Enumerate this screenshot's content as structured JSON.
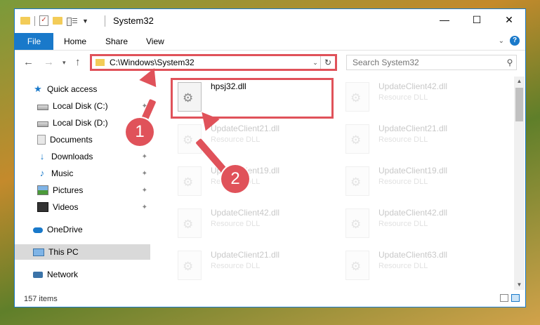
{
  "window": {
    "title": "System32",
    "controls": {
      "minimize": "—",
      "maximize": "☐",
      "close": "✕"
    }
  },
  "ribbon": {
    "tabs": [
      "File",
      "Home",
      "Share",
      "View"
    ],
    "expand_icon": "chevron-down-icon",
    "help_label": "?"
  },
  "address": {
    "path": "C:\\Windows\\System32",
    "search_placeholder": "Search System32"
  },
  "nav_pane": {
    "items": [
      {
        "label": "Quick access",
        "icon": "star-icon",
        "pinned": false
      },
      {
        "label": "Local Disk (C:)",
        "icon": "drive-icon",
        "pinned": true
      },
      {
        "label": "Local Disk (D:)",
        "icon": "drive-icon",
        "pinned": false
      },
      {
        "label": "Documents",
        "icon": "documents-icon",
        "pinned": true
      },
      {
        "label": "Downloads",
        "icon": "downloads-icon",
        "pinned": true
      },
      {
        "label": "Music",
        "icon": "music-icon",
        "pinned": true
      },
      {
        "label": "Pictures",
        "icon": "pictures-icon",
        "pinned": true
      },
      {
        "label": "Videos",
        "icon": "videos-icon",
        "pinned": true
      },
      {
        "label": "OneDrive",
        "icon": "cloud-icon",
        "pinned": false
      },
      {
        "label": "This PC",
        "icon": "computer-icon",
        "pinned": false,
        "selected": true
      },
      {
        "label": "Network",
        "icon": "network-icon",
        "pinned": false
      }
    ]
  },
  "files": [
    {
      "name": "hpsj32.dll",
      "type": "",
      "highlighted": true
    },
    {
      "name": "UpdateClient42.dll",
      "type": "Resource DLL"
    },
    {
      "name": "UpdateClient21.dll",
      "type": "Resource DLL"
    },
    {
      "name": "UpdateClient21.dll",
      "type": "Resource DLL"
    },
    {
      "name": "UpdateClient19.dll",
      "type": "Resource DLL"
    },
    {
      "name": "UpdateClient19.dll",
      "type": "Resource DLL"
    },
    {
      "name": "UpdateClient42.dll",
      "type": "Resource DLL"
    },
    {
      "name": "UpdateClient42.dll",
      "type": "Resource DLL"
    },
    {
      "name": "UpdateClient21.dll",
      "type": "Resource DLL"
    },
    {
      "name": "UpdateClient63.dll",
      "type": "Resource DLL"
    }
  ],
  "status": {
    "item_count": "157 items"
  },
  "annotations": {
    "callout_1": "1",
    "callout_2": "2",
    "accent_color": "#e0525a"
  },
  "colors": {
    "accent": "#1979ca",
    "selection": "#d9d9d9"
  }
}
